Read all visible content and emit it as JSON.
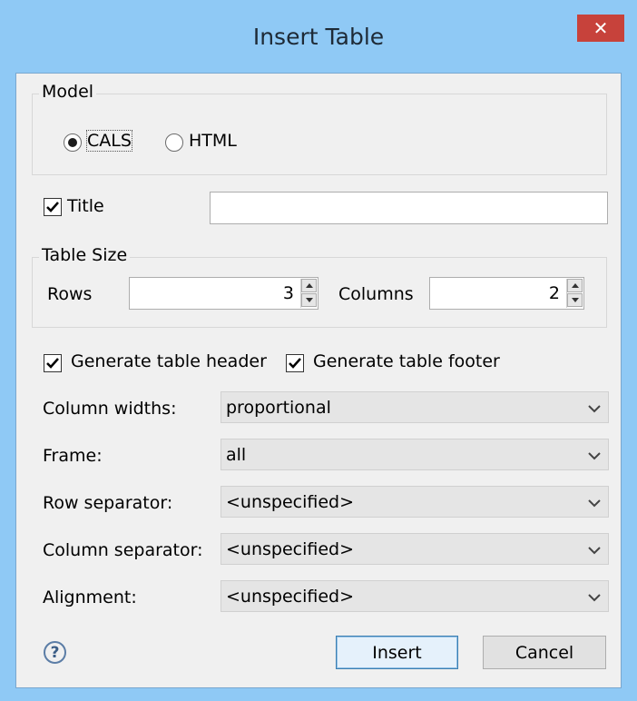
{
  "window": {
    "title": "Insert Table",
    "close_glyph": "✕"
  },
  "model": {
    "legend": "Model",
    "options": [
      {
        "label": "CALS",
        "selected": true
      },
      {
        "label": "HTML",
        "selected": false
      }
    ]
  },
  "title_row": {
    "label": "Title",
    "checked": true,
    "value": ""
  },
  "table_size": {
    "legend": "Table Size",
    "rows_label": "Rows",
    "rows_value": "3",
    "columns_label": "Columns",
    "columns_value": "2"
  },
  "options": {
    "header_label": "Generate table header",
    "header_checked": true,
    "footer_label": "Generate table footer",
    "footer_checked": true
  },
  "fields": [
    {
      "label": "Column widths:",
      "value": "proportional"
    },
    {
      "label": "Frame:",
      "value": "all"
    },
    {
      "label": "Row separator:",
      "value": "<unspecified>"
    },
    {
      "label": "Column separator:",
      "value": "<unspecified>"
    },
    {
      "label": "Alignment:",
      "value": "<unspecified>"
    }
  ],
  "buttons": {
    "help": "?",
    "insert": "Insert",
    "cancel": "Cancel"
  },
  "colors": {
    "title_bar": "#8fc9f5",
    "close_button": "#c7423b",
    "body": "#f0f0f0"
  },
  "icons": [
    "close-icon",
    "spin-up-icon",
    "spin-down-icon",
    "chevron-down-icon",
    "help-icon",
    "checkmark-icon"
  ]
}
